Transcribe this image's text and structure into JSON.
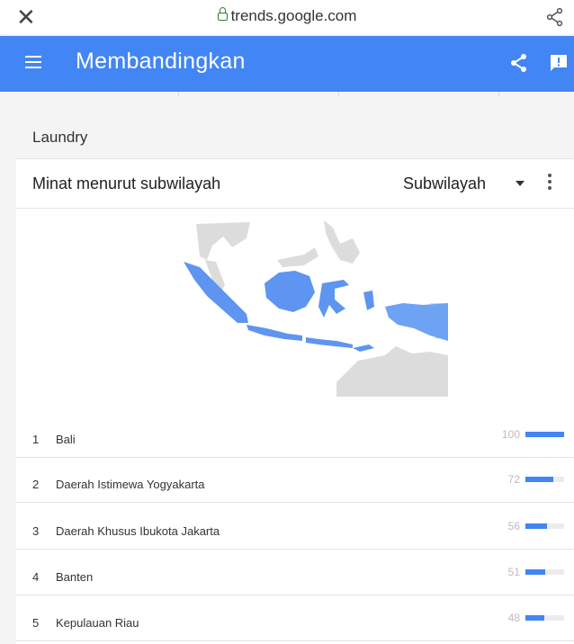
{
  "browser": {
    "url": "trends.google.com"
  },
  "app_bar": {
    "title": "Membandingkan"
  },
  "section": {
    "term": "Laundry"
  },
  "card": {
    "title": "Minat menurut subwilayah",
    "region_select_value": "Subwilayah"
  },
  "colors": {
    "accent": "#4285f4",
    "map_land": "#dcdcdc",
    "map_fill": "#5d95f0"
  },
  "icons": [
    "close-icon",
    "lock-icon",
    "share-icon",
    "menu-icon",
    "feedback-icon",
    "dropdown-icon",
    "more-vert-icon"
  ],
  "rankings": [
    {
      "rank": "1",
      "name": "Bali",
      "value": "100",
      "fraction": 1.0
    },
    {
      "rank": "2",
      "name": "Daerah Istimewa Yogyakarta",
      "value": "72",
      "fraction": 0.72
    },
    {
      "rank": "3",
      "name": "Daerah Khusus Ibukota Jakarta",
      "value": "56",
      "fraction": 0.56
    },
    {
      "rank": "4",
      "name": "Banten",
      "value": "51",
      "fraction": 0.51
    },
    {
      "rank": "5",
      "name": "Kepulauan Riau",
      "value": "48",
      "fraction": 0.48
    }
  ]
}
